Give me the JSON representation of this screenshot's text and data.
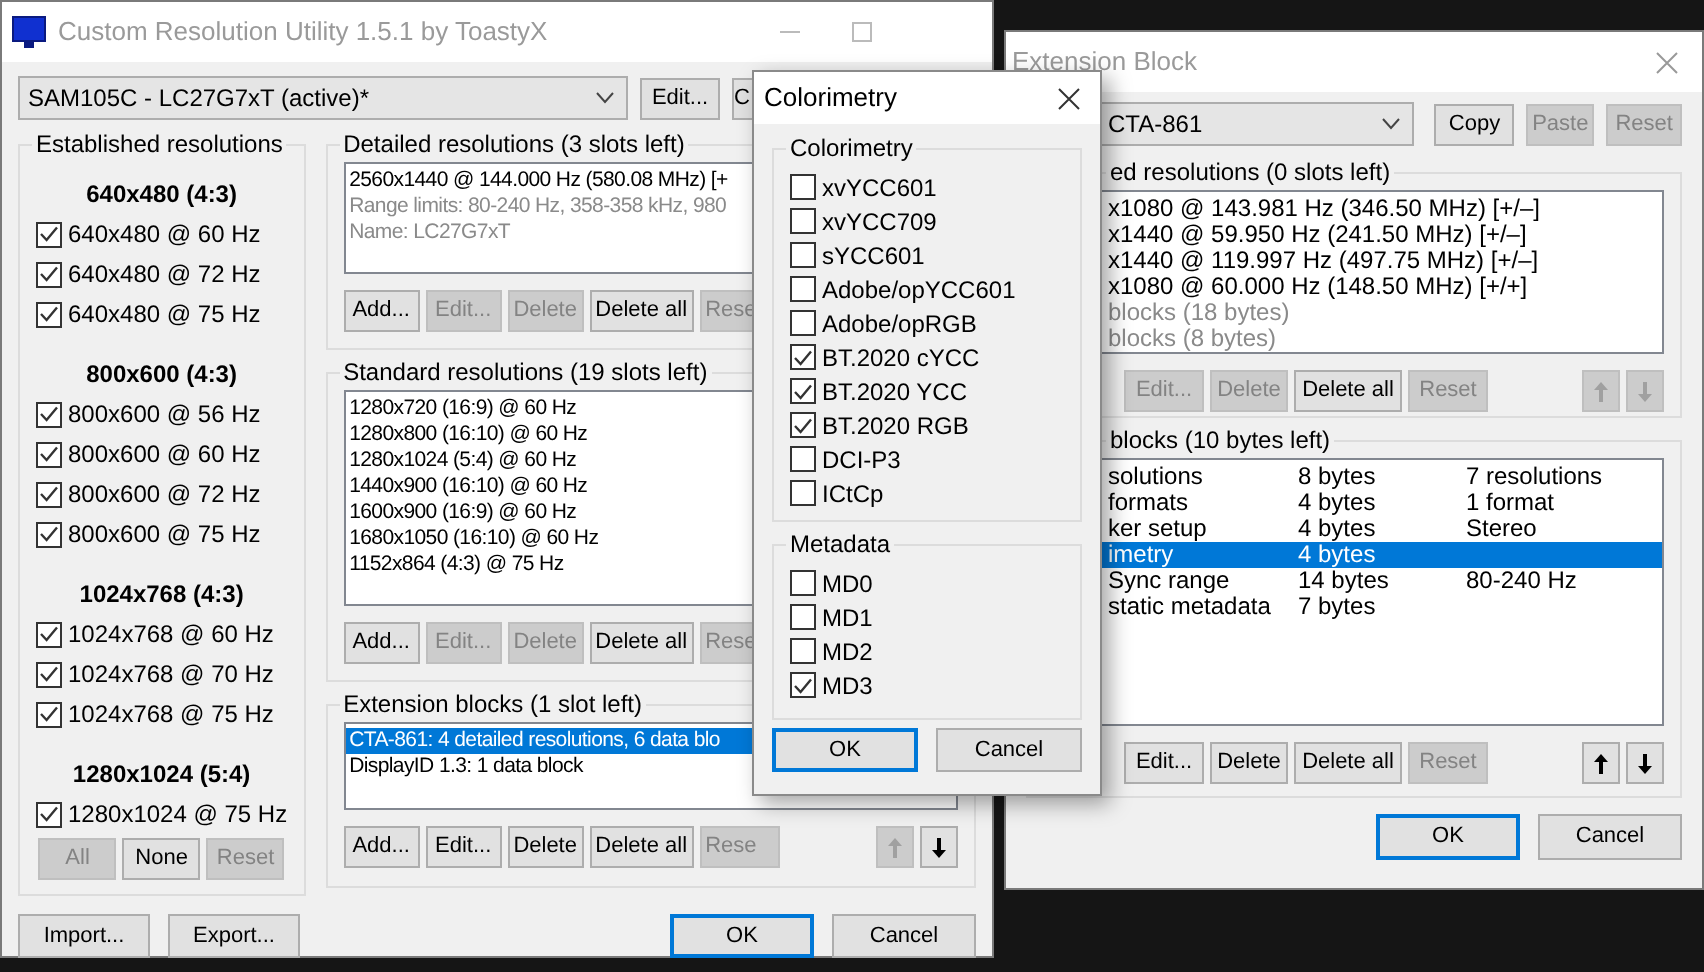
{
  "main_window": {
    "title": "Custom Resolution Utility 1.5.1 by ToastyX",
    "display_select": "SAM105C - LC27G7xT (active)*",
    "top_buttons": [
      {
        "label": "Edit...",
        "disabled": false
      },
      {
        "label": "C",
        "disabled": false
      }
    ],
    "established": {
      "title": "Established resolutions",
      "groups": [
        {
          "heading": "640x480 (4:3)",
          "items": [
            {
              "label": "640x480 @ 60 Hz",
              "checked": true
            },
            {
              "label": "640x480 @ 72 Hz",
              "checked": true
            },
            {
              "label": "640x480 @ 75 Hz",
              "checked": true
            }
          ]
        },
        {
          "heading": "800x600 (4:3)",
          "items": [
            {
              "label": "800x600 @ 56 Hz",
              "checked": true
            },
            {
              "label": "800x600 @ 60 Hz",
              "checked": true
            },
            {
              "label": "800x600 @ 72 Hz",
              "checked": true
            },
            {
              "label": "800x600 @ 75 Hz",
              "checked": true
            }
          ]
        },
        {
          "heading": "1024x768 (4:3)",
          "items": [
            {
              "label": "1024x768 @ 60 Hz",
              "checked": true
            },
            {
              "label": "1024x768 @ 70 Hz",
              "checked": true
            },
            {
              "label": "1024x768 @ 75 Hz",
              "checked": true
            }
          ]
        },
        {
          "heading": "1280x1024 (5:4)",
          "items": [
            {
              "label": "1280x1024 @ 75 Hz",
              "checked": true
            }
          ]
        }
      ],
      "buttons": [
        {
          "label": "All",
          "disabled": true
        },
        {
          "label": "None",
          "disabled": false
        },
        {
          "label": "Reset",
          "disabled": true
        }
      ]
    },
    "detailed": {
      "title": "Detailed resolutions (3 slots left)",
      "rows": [
        {
          "text": "2560x1440 @ 144.000 Hz (580.08 MHz) [+",
          "muted": false,
          "selected": false
        },
        {
          "text": "Range limits: 80-240 Hz, 358-358 kHz, 980",
          "muted": true,
          "selected": false
        },
        {
          "text": "Name: LC27G7xT",
          "muted": true,
          "selected": false
        }
      ],
      "buttons": [
        {
          "label": "Add...",
          "disabled": false
        },
        {
          "label": "Edit...",
          "disabled": true
        },
        {
          "label": "Delete",
          "disabled": true
        },
        {
          "label": "Delete all",
          "disabled": false
        },
        {
          "label": "Rese",
          "disabled": true
        }
      ]
    },
    "standard": {
      "title": "Standard resolutions (19 slots left)",
      "rows": [
        {
          "text": "1280x720 (16:9) @ 60 Hz",
          "muted": false,
          "selected": false
        },
        {
          "text": "1280x800 (16:10) @ 60 Hz",
          "muted": false,
          "selected": false
        },
        {
          "text": "1280x1024 (5:4) @ 60 Hz",
          "muted": false,
          "selected": false
        },
        {
          "text": "1440x900 (16:10) @ 60 Hz",
          "muted": false,
          "selected": false
        },
        {
          "text": "1600x900 (16:9) @ 60 Hz",
          "muted": false,
          "selected": false
        },
        {
          "text": "1680x1050 (16:10) @ 60 Hz",
          "muted": false,
          "selected": false
        },
        {
          "text": "1152x864 (4:3) @ 75 Hz",
          "muted": false,
          "selected": false
        }
      ],
      "buttons": [
        {
          "label": "Add...",
          "disabled": false
        },
        {
          "label": "Edit...",
          "disabled": true
        },
        {
          "label": "Delete",
          "disabled": true
        },
        {
          "label": "Delete all",
          "disabled": false
        },
        {
          "label": "Rese",
          "disabled": true
        }
      ]
    },
    "extension_blocks": {
      "title": "Extension blocks (1 slot left)",
      "rows": [
        {
          "text": "CTA-861: 4 detailed resolutions, 6 data blo",
          "muted": false,
          "selected": true
        },
        {
          "text": "DisplayID 1.3: 1 data block",
          "muted": false,
          "selected": false
        }
      ],
      "buttons": [
        {
          "label": "Add...",
          "disabled": false
        },
        {
          "label": "Edit...",
          "disabled": false
        },
        {
          "label": "Delete",
          "disabled": false
        },
        {
          "label": "Delete all",
          "disabled": false
        },
        {
          "label": "Rese",
          "disabled": true
        }
      ],
      "move_buttons": [
        {
          "disabled": true
        },
        {
          "disabled": false
        }
      ]
    },
    "bottom_buttons": [
      {
        "label": "Import...",
        "disabled": false
      },
      {
        "label": "Export...",
        "disabled": false
      }
    ],
    "dialog_buttons": [
      {
        "label": "OK",
        "default": true
      },
      {
        "label": "Cancel",
        "default": false
      }
    ]
  },
  "extension_window": {
    "title": "Extension Block",
    "type_select": "CTA-861",
    "top_buttons": [
      {
        "label": "Copy",
        "disabled": false
      },
      {
        "label": "Paste",
        "disabled": true
      },
      {
        "label": "Reset",
        "disabled": true
      }
    ],
    "detailed": {
      "title": "ed resolutions (0 slots left)",
      "rows": [
        {
          "text": "x1080 @ 143.981 Hz (346.50 MHz) [+/–]",
          "muted": false
        },
        {
          "text": "x1440 @ 59.950 Hz (241.50 MHz) [+/–]",
          "muted": false
        },
        {
          "text": "x1440 @ 119.997 Hz (497.75 MHz) [+/–]",
          "muted": false
        },
        {
          "text": "x1080 @ 60.000 Hz (148.50 MHz) [+/+]",
          "muted": false
        },
        {
          "text": "blocks (18 bytes)",
          "muted": true
        },
        {
          "text": "blocks (8 bytes)",
          "muted": true
        }
      ],
      "buttons": [
        {
          "label": "Edit...",
          "disabled": true
        },
        {
          "label": "Delete",
          "disabled": true
        },
        {
          "label": "Delete all",
          "disabled": false
        },
        {
          "label": "Reset",
          "disabled": true
        }
      ],
      "move_buttons": [
        {
          "disabled": true
        },
        {
          "disabled": true
        }
      ]
    },
    "data_blocks": {
      "title": "blocks (10 bytes left)",
      "rows": [
        {
          "name": "solutions",
          "size": "8 bytes",
          "info": "7 resolutions",
          "selected": false
        },
        {
          "name": "formats",
          "size": "4 bytes",
          "info": "1 format",
          "selected": false
        },
        {
          "name": "ker setup",
          "size": "4 bytes",
          "info": "Stereo",
          "selected": false
        },
        {
          "name": "imetry",
          "size": "4 bytes",
          "selected": true
        },
        {
          "name": "Sync range",
          "size": "14 bytes",
          "info": "80-240 Hz",
          "selected": false
        },
        {
          "name": "static metadata",
          "size": "7 bytes",
          "selected": false
        }
      ],
      "buttons": [
        {
          "label": "Edit...",
          "disabled": false
        },
        {
          "label": "Delete",
          "disabled": false
        },
        {
          "label": "Delete all",
          "disabled": false
        },
        {
          "label": "Reset",
          "disabled": true
        }
      ],
      "move_buttons": [
        {
          "disabled": false
        },
        {
          "disabled": false
        }
      ]
    },
    "dialog_buttons": [
      {
        "label": "OK",
        "default": true
      },
      {
        "label": "Cancel",
        "default": false
      }
    ]
  },
  "colorimetry_dialog": {
    "title": "Colorimetry",
    "groups": [
      {
        "title": "Colorimetry",
        "items": [
          {
            "label": "xvYCC601",
            "checked": false
          },
          {
            "label": "xvYCC709",
            "checked": false
          },
          {
            "label": "sYCC601",
            "checked": false
          },
          {
            "label": "Adobe/opYCC601",
            "checked": false
          },
          {
            "label": "Adobe/opRGB",
            "checked": false
          },
          {
            "label": "BT.2020 cYCC",
            "checked": true
          },
          {
            "label": "BT.2020 YCC",
            "checked": true
          },
          {
            "label": "BT.2020 RGB",
            "checked": true
          },
          {
            "label": "DCI-P3",
            "checked": false
          },
          {
            "label": "ICtCp",
            "checked": false
          }
        ]
      },
      {
        "title": "Metadata",
        "items": [
          {
            "label": "MD0",
            "checked": false
          },
          {
            "label": "MD1",
            "checked": false
          },
          {
            "label": "MD2",
            "checked": false
          },
          {
            "label": "MD3",
            "checked": true
          }
        ]
      }
    ],
    "buttons": [
      {
        "label": "OK",
        "default": true
      },
      {
        "label": "Cancel",
        "default": false
      }
    ]
  }
}
